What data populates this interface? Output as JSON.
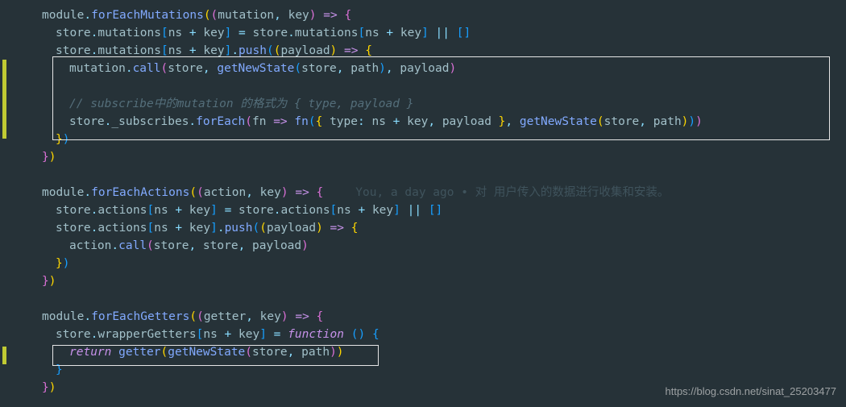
{
  "code": {
    "l1_a": "module",
    "l1_b": "forEachMutations",
    "l1_c": "mutation",
    "l1_d": "key",
    "l2_a": "store",
    "l2_b": "mutations",
    "l2_c": "ns",
    "l2_d": "key",
    "l3_a": "push",
    "l3_b": "payload",
    "l4_a": "mutation",
    "l4_b": "call",
    "l4_c": "store",
    "l4_d": "getNewState",
    "l4_e": "path",
    "l4_f": "payload",
    "l6_comment": "// subscribe中的mutation 的格式为 { type, payload }",
    "l7_a": "store",
    "l7_b": "_subscribes",
    "l7_c": "forEach",
    "l7_d": "fn",
    "l7_e": "type",
    "l7_f": "ns",
    "l7_g": "key",
    "l7_h": "payload",
    "l7_i": "getNewState",
    "l7_j": "path",
    "l11_a": "module",
    "l11_b": "forEachActions",
    "l11_c": "action",
    "l11_d": "key",
    "l12_a": "store",
    "l12_b": "actions",
    "l12_c": "ns",
    "l12_d": "key",
    "l13_a": "push",
    "l13_b": "payload",
    "l14_a": "action",
    "l14_b": "call",
    "l14_c": "store",
    "l14_d": "payload",
    "l18_a": "module",
    "l18_b": "forEachGetters",
    "l18_c": "getter",
    "l18_d": "key",
    "l19_a": "store",
    "l19_b": "wrapperGetters",
    "l19_c": "ns",
    "l19_d": "key",
    "l19_e": "function",
    "l20_a": "return",
    "l20_b": "getter",
    "l20_c": "getNewState",
    "l20_d": "store",
    "l20_e": "path"
  },
  "blame": {
    "author": "You, a day ago",
    "sep": " • ",
    "msg": "对 用户传入的数据进行收集和安装。"
  },
  "watermark": "https://blog.csdn.net/sinat_25203477"
}
